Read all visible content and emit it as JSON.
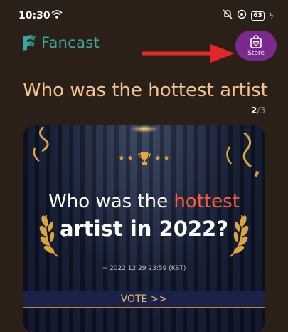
{
  "status_bar": {
    "time": "10:30",
    "battery": "63"
  },
  "header": {
    "logo_text": "Fancast",
    "store_label": "Store"
  },
  "poll": {
    "title": "Who was the hottest artist...",
    "page_current": "2",
    "page_total": "/3",
    "card": {
      "headline_prefix": "Who was the ",
      "headline_highlight": "hottest",
      "headline_line2": "artist in 2022?",
      "date": "~ 2022.12.29 23:59 (KST)",
      "vote_label": "VOTE >>"
    }
  },
  "colors": {
    "background": "#2b2018",
    "store_button": "#7a2a8c",
    "logo": "#3ba69b",
    "title": "#f2c394",
    "arrow": "#e3262b",
    "highlight": "#ff5a3c"
  }
}
